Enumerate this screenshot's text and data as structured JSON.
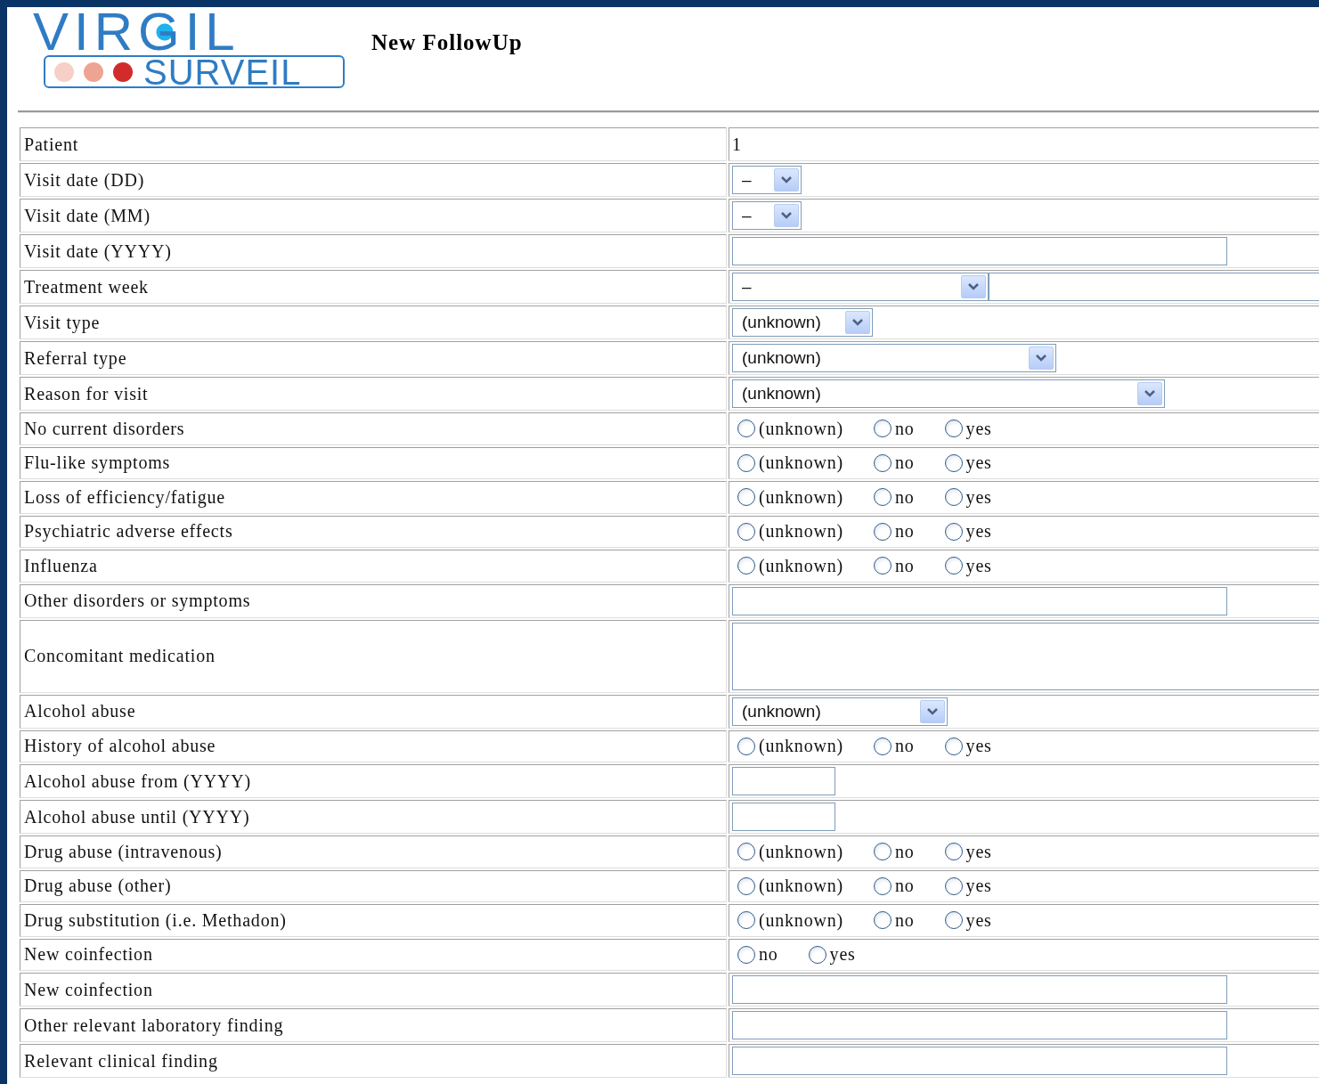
{
  "logo": {
    "title": "VIRGIL",
    "subtitle": "SURVEIL"
  },
  "page_title": "New FollowUp",
  "fields": [
    {
      "label": "Patient",
      "kind": "text",
      "value": "1"
    },
    {
      "label": "Visit date (DD)",
      "kind": "select",
      "value": "–"
    },
    {
      "label": "Visit date (MM)",
      "kind": "select",
      "value": "–"
    },
    {
      "label": "Visit date (YYYY)",
      "kind": "input"
    },
    {
      "label": "Treatment week",
      "kind": "select_input",
      "value": "–"
    },
    {
      "label": "Visit type",
      "kind": "select",
      "value": "(unknown)"
    },
    {
      "label": "Referral type",
      "kind": "select",
      "value": "(unknown)"
    },
    {
      "label": "Reason for visit",
      "kind": "select",
      "value": "(unknown)"
    },
    {
      "label": "No current disorders",
      "kind": "radio",
      "options": [
        {
          "label": "(unknown)",
          "selected": false
        },
        {
          "label": "no",
          "selected": false
        },
        {
          "label": "yes",
          "selected": false
        }
      ]
    },
    {
      "label": "Flu-like symptoms",
      "kind": "radio",
      "options": [
        {
          "label": "(unknown)",
          "selected": false
        },
        {
          "label": "no",
          "selected": false
        },
        {
          "label": "yes",
          "selected": false
        }
      ]
    },
    {
      "label": "Loss of efficiency/fatigue",
      "kind": "radio",
      "options": [
        {
          "label": "(unknown)",
          "selected": false
        },
        {
          "label": "no",
          "selected": false
        },
        {
          "label": "yes",
          "selected": false
        }
      ]
    },
    {
      "label": "Psychiatric adverse effects",
      "kind": "radio",
      "options": [
        {
          "label": "(unknown)",
          "selected": false
        },
        {
          "label": "no",
          "selected": false
        },
        {
          "label": "yes",
          "selected": false
        }
      ]
    },
    {
      "label": "Influenza",
      "kind": "radio",
      "options": [
        {
          "label": "(unknown)",
          "selected": false
        },
        {
          "label": "no",
          "selected": false
        },
        {
          "label": "yes",
          "selected": false
        }
      ]
    },
    {
      "label": "Other disorders or symptoms",
      "kind": "input"
    },
    {
      "label": "Concomitant medication",
      "kind": "textarea"
    },
    {
      "label": "Alcohol abuse",
      "kind": "select",
      "value": "(unknown)"
    },
    {
      "label": "History of alcohol abuse",
      "kind": "radio",
      "options": [
        {
          "label": "(unknown)",
          "selected": false
        },
        {
          "label": "no",
          "selected": false
        },
        {
          "label": "yes",
          "selected": false
        }
      ]
    },
    {
      "label": "Alcohol abuse from (YYYY)",
      "kind": "input"
    },
    {
      "label": "Alcohol abuse until (YYYY)",
      "kind": "input"
    },
    {
      "label": "Drug abuse (intravenous)",
      "kind": "radio",
      "options": [
        {
          "label": "(unknown)",
          "selected": false
        },
        {
          "label": "no",
          "selected": false
        },
        {
          "label": "yes",
          "selected": false
        }
      ]
    },
    {
      "label": "Drug abuse (other)",
      "kind": "radio",
      "options": [
        {
          "label": "(unknown)",
          "selected": false
        },
        {
          "label": "no",
          "selected": false
        },
        {
          "label": "yes",
          "selected": false
        }
      ]
    },
    {
      "label": "Drug substitution (i.e. Methadon)",
      "kind": "radio",
      "options": [
        {
          "label": "(unknown)",
          "selected": false
        },
        {
          "label": "no",
          "selected": false
        },
        {
          "label": "yes",
          "selected": false
        }
      ]
    },
    {
      "label": "New coinfection",
      "kind": "radio",
      "options": [
        {
          "label": "no",
          "selected": false
        },
        {
          "label": "yes",
          "selected": false
        }
      ]
    },
    {
      "label": "New coinfection",
      "kind": "input"
    },
    {
      "label": "Other relevant laboratory finding",
      "kind": "input"
    },
    {
      "label": "Relevant clinical finding",
      "kind": "input"
    }
  ]
}
